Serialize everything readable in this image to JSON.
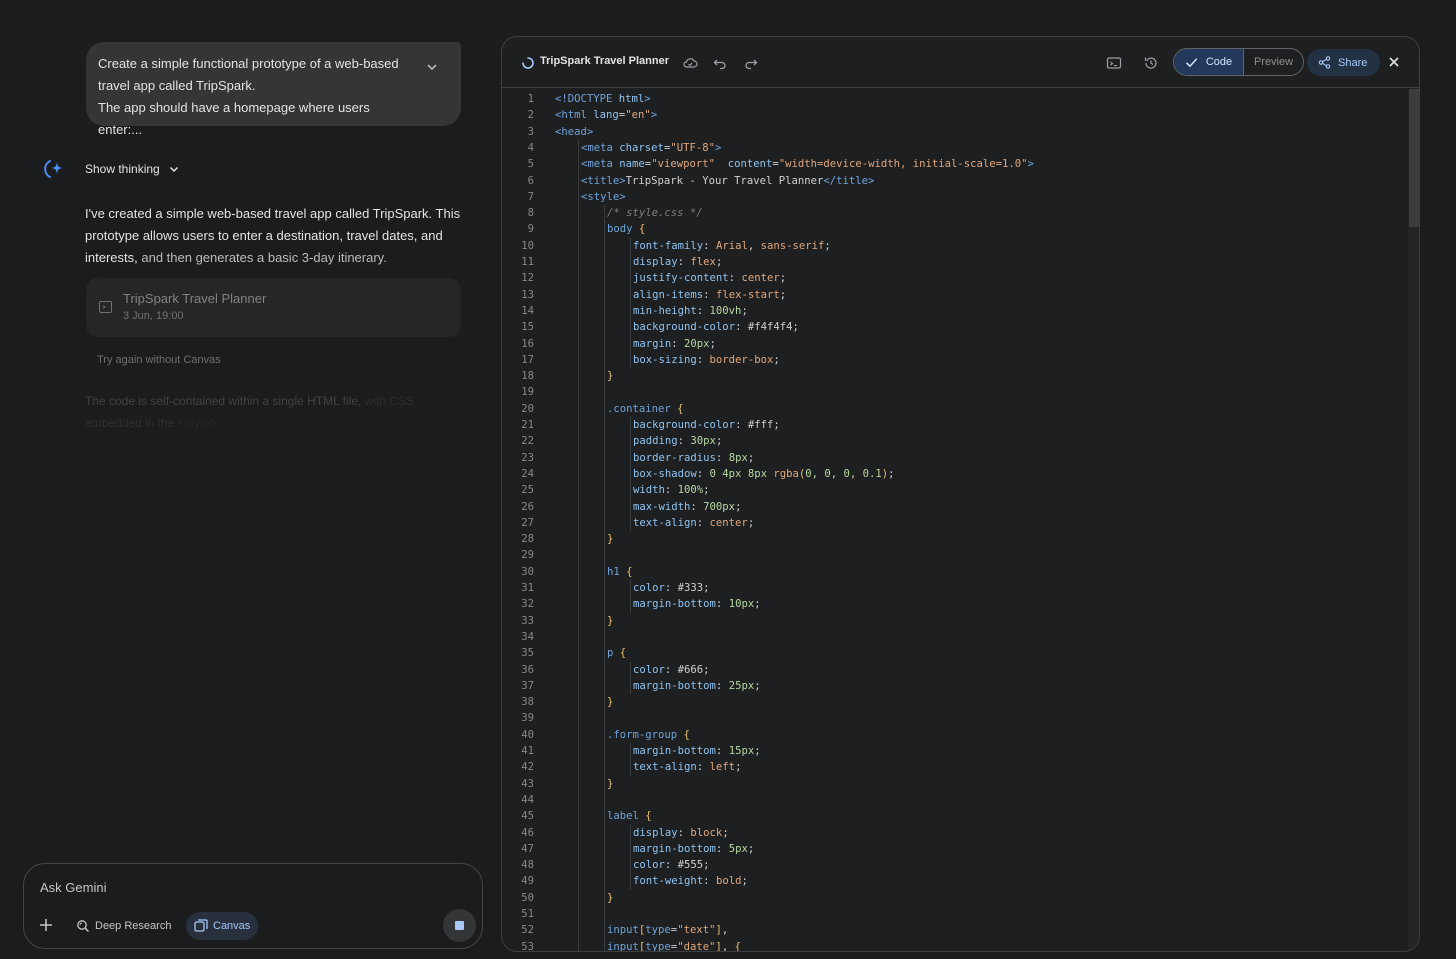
{
  "chat": {
    "user_prompt_lines": [
      "Create a simple functional prototype of a web-based",
      "travel app called TripSpark.",
      "The app should have a homepage where users enter:..."
    ],
    "show_thinking_label": "Show thinking",
    "answer_part1": "I've created a simple web-based travel app called TripSpark. This prototype allows users to enter a destination, travel dates, and interests,",
    "answer_part2": " and then generates a basic 3-day itinerary.",
    "canvas_card": {
      "title": "TripSpark Travel Planner",
      "timestamp": "3 Jun, 19:00"
    },
    "try_again_label": "Try again without Canvas",
    "faded_text_part1": "The code is self-contained within a single HTML file,",
    "faded_text_part2": " with CSS embedded in the",
    "faded_text_part3": " <style>"
  },
  "input": {
    "placeholder": "Ask Gemini",
    "deep_research_label": "Deep Research",
    "canvas_label": "Canvas"
  },
  "editor": {
    "title": "TripSpark Travel Planner",
    "code_tab_label": "Code",
    "preview_tab_label": "Preview",
    "share_label": "Share"
  },
  "code_lines": [
    {
      "n": "1",
      "i": 0,
      "t": [
        [
          "tag",
          "<!DOCTYPE "
        ],
        [
          "attr",
          "html"
        ],
        [
          "tag",
          ">"
        ]
      ]
    },
    {
      "n": "2",
      "i": 0,
      "t": [
        [
          "tag",
          "<html "
        ],
        [
          "attr",
          "lang"
        ],
        [
          "",
          "="
        ],
        [
          "str",
          "\"en\""
        ],
        [
          "tag",
          ">"
        ]
      ]
    },
    {
      "n": "3",
      "i": 0,
      "t": [
        [
          "tag",
          "<head>"
        ]
      ]
    },
    {
      "n": "4",
      "i": 1,
      "t": [
        [
          "tag",
          "<meta "
        ],
        [
          "attr",
          "charset"
        ],
        [
          "",
          "="
        ],
        [
          "str",
          "\"UTF-8\""
        ],
        [
          "tag",
          ">"
        ]
      ]
    },
    {
      "n": "5",
      "i": 1,
      "t": [
        [
          "tag",
          "<meta "
        ],
        [
          "attr",
          "name"
        ],
        [
          "",
          "="
        ],
        [
          "str",
          "\"viewport\""
        ],
        [
          "",
          "  "
        ],
        [
          "attr",
          "content"
        ],
        [
          "",
          "="
        ],
        [
          "str",
          "\"width=device-width, initial-scale=1.0\""
        ],
        [
          "tag",
          ">"
        ]
      ]
    },
    {
      "n": "6",
      "i": 1,
      "t": [
        [
          "tag",
          "<title>"
        ],
        [
          "",
          "TripSpark - Your Travel Planner"
        ],
        [
          "tag",
          "</title>"
        ]
      ]
    },
    {
      "n": "7",
      "i": 1,
      "t": [
        [
          "tag",
          "<style>"
        ]
      ]
    },
    {
      "n": "8",
      "i": 2,
      "t": [
        [
          "cmt",
          "/* style.css */"
        ]
      ]
    },
    {
      "n": "9",
      "i": 2,
      "t": [
        [
          "sel",
          "body "
        ],
        [
          "br",
          "{"
        ]
      ]
    },
    {
      "n": "10",
      "i": 3,
      "t": [
        [
          "prop",
          "font-family"
        ],
        [
          "",
          ": "
        ],
        [
          "val",
          "Arial"
        ],
        [
          "",
          ", "
        ],
        [
          "val",
          "sans-serif"
        ],
        [
          "",
          ";"
        ]
      ]
    },
    {
      "n": "11",
      "i": 3,
      "t": [
        [
          "prop",
          "display"
        ],
        [
          "",
          ": "
        ],
        [
          "val",
          "flex"
        ],
        [
          "",
          ";"
        ]
      ]
    },
    {
      "n": "12",
      "i": 3,
      "t": [
        [
          "prop",
          "justify-content"
        ],
        [
          "",
          ": "
        ],
        [
          "val",
          "center"
        ],
        [
          "",
          ";"
        ]
      ]
    },
    {
      "n": "13",
      "i": 3,
      "t": [
        [
          "prop",
          "align-items"
        ],
        [
          "",
          ": "
        ],
        [
          "val",
          "flex-start"
        ],
        [
          "",
          ";"
        ]
      ]
    },
    {
      "n": "14",
      "i": 3,
      "t": [
        [
          "prop",
          "min-height"
        ],
        [
          "",
          ": "
        ],
        [
          "num",
          "100vh"
        ],
        [
          "",
          ";"
        ]
      ]
    },
    {
      "n": "15",
      "i": 3,
      "t": [
        [
          "prop",
          "background-color"
        ],
        [
          "",
          ": #f4f4f4;"
        ]
      ]
    },
    {
      "n": "16",
      "i": 3,
      "t": [
        [
          "prop",
          "margin"
        ],
        [
          "",
          ": "
        ],
        [
          "num",
          "20px"
        ],
        [
          "",
          ";"
        ]
      ]
    },
    {
      "n": "17",
      "i": 3,
      "t": [
        [
          "prop",
          "box-sizing"
        ],
        [
          "",
          ": "
        ],
        [
          "val",
          "border-box"
        ],
        [
          "",
          ";"
        ]
      ]
    },
    {
      "n": "18",
      "i": 2,
      "t": [
        [
          "br",
          "}"
        ]
      ]
    },
    {
      "n": "19",
      "i": 0,
      "t": []
    },
    {
      "n": "20",
      "i": 2,
      "t": [
        [
          "sel",
          ".container "
        ],
        [
          "br",
          "{"
        ]
      ]
    },
    {
      "n": "21",
      "i": 3,
      "t": [
        [
          "prop",
          "background-color"
        ],
        [
          "",
          ": #fff;"
        ]
      ]
    },
    {
      "n": "22",
      "i": 3,
      "t": [
        [
          "prop",
          "padding"
        ],
        [
          "",
          ": "
        ],
        [
          "num",
          "30px"
        ],
        [
          "",
          ";"
        ]
      ]
    },
    {
      "n": "23",
      "i": 3,
      "t": [
        [
          "prop",
          "border-radius"
        ],
        [
          "",
          ": "
        ],
        [
          "num",
          "8px"
        ],
        [
          "",
          ";"
        ]
      ]
    },
    {
      "n": "24",
      "i": 3,
      "t": [
        [
          "prop",
          "box-shadow"
        ],
        [
          "",
          ": "
        ],
        [
          "num",
          "0 4px 8px "
        ],
        [
          "fn",
          "rgba"
        ],
        [
          "br",
          "("
        ],
        [
          "num",
          "0, 0, 0, 0.1"
        ],
        [
          "br",
          ")"
        ],
        [
          "",
          ";"
        ]
      ]
    },
    {
      "n": "25",
      "i": 3,
      "t": [
        [
          "prop",
          "width"
        ],
        [
          "",
          ": "
        ],
        [
          "num",
          "100%"
        ],
        [
          "",
          ";"
        ]
      ]
    },
    {
      "n": "26",
      "i": 3,
      "t": [
        [
          "prop",
          "max-width"
        ],
        [
          "",
          ": "
        ],
        [
          "num",
          "700px"
        ],
        [
          "",
          ";"
        ]
      ]
    },
    {
      "n": "27",
      "i": 3,
      "t": [
        [
          "prop",
          "text-align"
        ],
        [
          "",
          ": "
        ],
        [
          "val",
          "center"
        ],
        [
          "",
          ";"
        ]
      ]
    },
    {
      "n": "28",
      "i": 2,
      "t": [
        [
          "br",
          "}"
        ]
      ]
    },
    {
      "n": "29",
      "i": 0,
      "t": []
    },
    {
      "n": "30",
      "i": 2,
      "t": [
        [
          "sel",
          "h1 "
        ],
        [
          "br",
          "{"
        ]
      ]
    },
    {
      "n": "31",
      "i": 3,
      "t": [
        [
          "prop",
          "color"
        ],
        [
          "",
          ": #333;"
        ]
      ]
    },
    {
      "n": "32",
      "i": 3,
      "t": [
        [
          "prop",
          "margin-bottom"
        ],
        [
          "",
          ": "
        ],
        [
          "num",
          "10px"
        ],
        [
          "",
          ";"
        ]
      ]
    },
    {
      "n": "33",
      "i": 2,
      "t": [
        [
          "br",
          "}"
        ]
      ]
    },
    {
      "n": "34",
      "i": 0,
      "t": []
    },
    {
      "n": "35",
      "i": 2,
      "t": [
        [
          "sel",
          "p "
        ],
        [
          "br",
          "{"
        ]
      ]
    },
    {
      "n": "36",
      "i": 3,
      "t": [
        [
          "prop",
          "color"
        ],
        [
          "",
          ": #666;"
        ]
      ]
    },
    {
      "n": "37",
      "i": 3,
      "t": [
        [
          "prop",
          "margin-bottom"
        ],
        [
          "",
          ": "
        ],
        [
          "num",
          "25px"
        ],
        [
          "",
          ";"
        ]
      ]
    },
    {
      "n": "38",
      "i": 2,
      "t": [
        [
          "br",
          "}"
        ]
      ]
    },
    {
      "n": "39",
      "i": 0,
      "t": []
    },
    {
      "n": "40",
      "i": 2,
      "t": [
        [
          "sel",
          ".form-group "
        ],
        [
          "br",
          "{"
        ]
      ]
    },
    {
      "n": "41",
      "i": 3,
      "t": [
        [
          "prop",
          "margin-bottom"
        ],
        [
          "",
          ": "
        ],
        [
          "num",
          "15px"
        ],
        [
          "",
          ";"
        ]
      ]
    },
    {
      "n": "42",
      "i": 3,
      "t": [
        [
          "prop",
          "text-align"
        ],
        [
          "",
          ": "
        ],
        [
          "val",
          "left"
        ],
        [
          "",
          ";"
        ]
      ]
    },
    {
      "n": "43",
      "i": 2,
      "t": [
        [
          "br",
          "}"
        ]
      ]
    },
    {
      "n": "44",
      "i": 0,
      "t": []
    },
    {
      "n": "45",
      "i": 2,
      "t": [
        [
          "sel",
          "label "
        ],
        [
          "br",
          "{"
        ]
      ]
    },
    {
      "n": "46",
      "i": 3,
      "t": [
        [
          "prop",
          "display"
        ],
        [
          "",
          ": "
        ],
        [
          "val",
          "block"
        ],
        [
          "",
          ";"
        ]
      ]
    },
    {
      "n": "47",
      "i": 3,
      "t": [
        [
          "prop",
          "margin-bottom"
        ],
        [
          "",
          ": "
        ],
        [
          "num",
          "5px"
        ],
        [
          "",
          ";"
        ]
      ]
    },
    {
      "n": "48",
      "i": 3,
      "t": [
        [
          "prop",
          "color"
        ],
        [
          "",
          ": #555;"
        ]
      ]
    },
    {
      "n": "49",
      "i": 3,
      "t": [
        [
          "prop",
          "font-weight"
        ],
        [
          "",
          ": "
        ],
        [
          "val",
          "bold"
        ],
        [
          "",
          ";"
        ]
      ]
    },
    {
      "n": "50",
      "i": 2,
      "t": [
        [
          "br",
          "}"
        ]
      ]
    },
    {
      "n": "51",
      "i": 0,
      "t": []
    },
    {
      "n": "52",
      "i": 2,
      "t": [
        [
          "sel",
          "input"
        ],
        [
          "br",
          "["
        ],
        [
          "sel",
          "type"
        ],
        [
          "",
          "="
        ],
        [
          "str",
          "\"text\""
        ],
        [
          "br",
          "]"
        ],
        [
          "",
          ","
        ]
      ]
    },
    {
      "n": "53",
      "i": 2,
      "t": [
        [
          "sel",
          "input"
        ],
        [
          "br",
          "["
        ],
        [
          "sel",
          "type"
        ],
        [
          "",
          "="
        ],
        [
          "str",
          "\"date\""
        ],
        [
          "br",
          "]"
        ],
        [
          "",
          ", "
        ],
        [
          "br",
          "{"
        ]
      ]
    }
  ]
}
